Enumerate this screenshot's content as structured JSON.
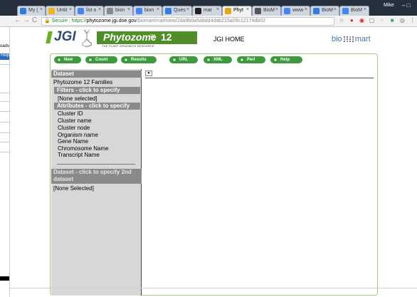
{
  "browser": {
    "tabs": [
      {
        "label": "My (",
        "favicon": "drive-icon",
        "color": "#2d7de0",
        "active": false
      },
      {
        "label": "Untit",
        "favicon": "doc-icon",
        "color": "#f2b31b",
        "active": false
      },
      {
        "label": "list o",
        "favicon": "google-icon",
        "color": "#4285f4",
        "active": false
      },
      {
        "label": "bion",
        "favicon": "page-icon",
        "color": "#888888",
        "active": false
      },
      {
        "label": "bion",
        "favicon": "google-icon",
        "color": "#4285f4",
        "active": false
      },
      {
        "label": "Ques",
        "favicon": "stack-icon",
        "color": "#2d7de0",
        "active": false
      },
      {
        "label": "mar",
        "favicon": "github-icon",
        "color": "#222222",
        "active": false
      },
      {
        "label": "Phyt",
        "favicon": "phyto-icon",
        "color": "#e8a317",
        "active": true
      },
      {
        "label": "BioM",
        "favicon": "grid-icon",
        "color": "#555555",
        "active": false
      },
      {
        "label": "www",
        "favicon": "google-icon",
        "color": "#4285f4",
        "active": false
      },
      {
        "label": "BioM",
        "favicon": "globe-icon",
        "color": "#2d7de0",
        "active": false
      },
      {
        "label": "BioM",
        "favicon": "google-icon",
        "color": "#4285f4",
        "active": false
      }
    ],
    "user_name": "Mike",
    "secure_label": "Secure",
    "url_scheme": "https://",
    "url_host": "phytozome.jgi.doe.gov",
    "url_rest": "/biomart/martview/2da9b0a6a8dd4dab215a09c12174db02"
  },
  "side_window": {
    "text1": "oads",
    "button": "Help"
  },
  "header": {
    "jgi_logo": "JGI",
    "phytozome_title": "Phytozome",
    "phytozome_version": "12",
    "tagline": "THE PLANT GENOMICS RESOURCE",
    "jgi_home": "JGI HOME",
    "biomart_left": "bio",
    "biomart_right": "mart"
  },
  "toolbar": {
    "new": "New",
    "count": "Count",
    "results": "Results",
    "url": "URL",
    "xml": "XML",
    "perl": "Perl",
    "help": "Help"
  },
  "left_panel": {
    "dataset_header": "Dataset",
    "dataset_name": "Phytozome 12 Families",
    "filters_header": "Filters - click to specify",
    "filters_value": "[None selected]",
    "attributes_header": "Attributes - click to specify",
    "attributes": [
      "Cluster ID",
      "Cluster name",
      "Cluster node",
      "Organism name",
      "Gene Name",
      "Chromosome Name",
      "Transcript Name"
    ],
    "dataset2_header_line1": "Dataset - click to specify 2nd",
    "dataset2_header_line2": "dataset",
    "dataset2_value": "[None Selected]"
  },
  "colors": {
    "toolbar_button": "#3d9b3d",
    "phytozome_banner": "#4f8d2a",
    "panel_header": "#8a8a8a",
    "panel_bg": "#d7d7d7"
  }
}
